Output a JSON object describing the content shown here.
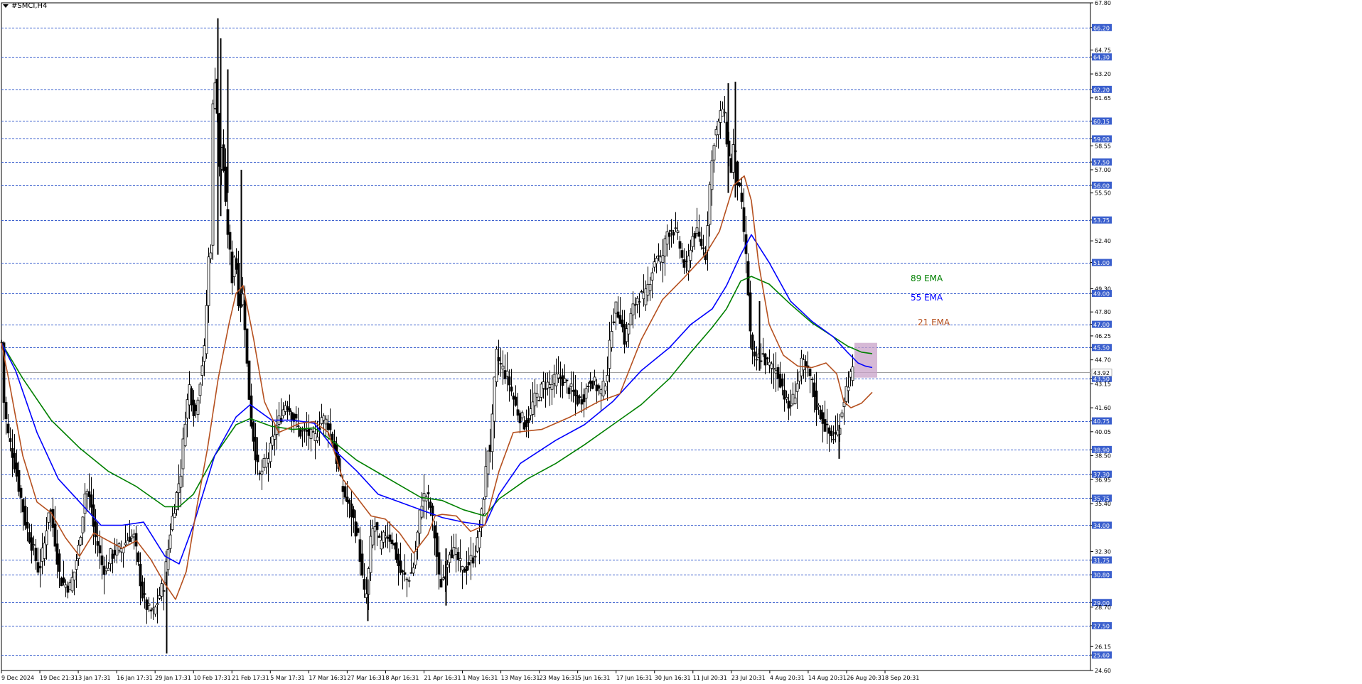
{
  "window": {
    "symbol_title": "#SMCI,H4"
  },
  "colors": {
    "grid": "#3a5fcd",
    "axis": "#000000",
    "ema21": "#b5501f",
    "ema55": "#0000ff",
    "ema89": "#008000",
    "highlight": "#c8a2c8",
    "price_label_bg": "#3a5fcd",
    "candle": "#000000"
  },
  "chart_data": {
    "type": "candlestick",
    "title": "#SMCI,H4",
    "ylim": [
      24.6,
      67.8
    ],
    "grid": true,
    "y_ticks": [
      "67.80",
      "66.20",
      "64.75",
      "64.30",
      "63.20",
      "62.20",
      "61.65",
      "60.15",
      "59.00",
      "58.55",
      "57.50",
      "57.00",
      "56.00",
      "55.50",
      "53.75",
      "52.40",
      "51.00",
      "49.30",
      "49.00",
      "47.80",
      "47.00",
      "46.25",
      "45.50",
      "44.70",
      "43.50",
      "43.15",
      "41.60",
      "40.75",
      "40.05",
      "38.90",
      "38.50",
      "37.30",
      "36.95",
      "35.75",
      "35.40",
      "34.00",
      "32.30",
      "31.75",
      "30.80",
      "29.00",
      "28.70",
      "27.50",
      "26.15",
      "25.60",
      "24.60"
    ],
    "grid_levels": [
      "66.20",
      "64.30",
      "62.20",
      "60.15",
      "59.00",
      "57.50",
      "56.00",
      "53.75",
      "51.00",
      "49.00",
      "47.00",
      "45.50",
      "43.50",
      "40.75",
      "38.90",
      "37.30",
      "35.75",
      "34.00",
      "31.75",
      "30.80",
      "29.00",
      "27.50",
      "25.60"
    ],
    "current_price": {
      "value": 43.92,
      "label": "43.92"
    },
    "x_labels": [
      "9 Dec 2024",
      "19 Dec 21:31",
      "3 Jan 17:31",
      "16 Jan 17:31",
      "29 Jan 17:31",
      "10 Feb 17:31",
      "21 Feb 17:31",
      "5 Mar 17:31",
      "17 Mar 16:31",
      "27 Mar 16:31",
      "8 Apr 16:31",
      "21 Apr 16:31",
      "1 May 16:31",
      "13 May 16:31",
      "23 May 16:31",
      "5 Jun 16:31",
      "17 Jun 16:31",
      "30 Jun 16:31",
      "11 Jul 20:31",
      "23 Jul 20:31",
      "4 Aug 20:31",
      "14 Aug 20:31",
      "26 Aug 20:31",
      "8 Sep 20:31"
    ],
    "close_path": {
      "t": [
        0,
        3,
        8,
        16,
        24,
        34,
        44,
        52,
        60,
        67,
        75,
        82,
        88,
        96,
        102,
        108,
        112,
        118,
        126,
        130,
        136,
        140,
        148,
        152,
        160,
        168,
        180,
        186,
        198,
        206,
        214,
        222,
        228,
        238,
        246,
        252,
        258,
        264,
        272,
        276,
        282,
        286,
        290,
        294,
        298,
        302,
        306,
        310,
        314,
        318,
        324,
        328,
        334,
        340,
        344,
        350,
        356,
        362,
        370,
        376,
        384,
        392,
        400,
        410,
        420,
        430,
        440,
        450,
        460,
        468,
        478,
        486,
        494,
        502,
        508,
        512,
        516,
        520,
        526,
        532,
        540,
        550,
        560,
        570,
        578,
        584,
        590,
        596,
        602,
        610,
        616,
        624,
        630,
        640,
        648,
        656,
        664,
        670,
        676,
        680,
        684,
        688,
        692,
        696,
        700,
        706,
        712,
        718,
        724,
        730,
        736,
        742,
        748,
        756,
        764,
        772,
        780,
        788,
        796,
        804,
        812,
        820,
        828,
        836,
        844,
        852,
        858,
        864,
        870,
        876,
        882,
        888,
        896,
        904,
        912,
        920,
        928,
        936,
        944,
        952,
        958,
        964,
        970,
        976,
        984,
        990,
        996,
        1002,
        1008,
        1014,
        1018,
        1022,
        1026,
        1030,
        1034,
        1040,
        1046,
        1050,
        1054,
        1058,
        1064,
        1070,
        1076,
        1082,
        1090,
        1098,
        1106,
        1114,
        1120,
        1126,
        1132,
        1138,
        1146,
        1152,
        1160,
        1166,
        1172,
        1176,
        1180,
        1186,
        1192,
        1198,
        1204,
        1210,
        1216,
        1220,
        1224,
        1228
      ],
      "close": [
        45.8,
        42,
        40,
        38.5,
        36.5,
        34,
        32.5,
        31,
        32.8,
        35.4,
        33,
        30.5,
        30.2,
        30,
        31,
        32.5,
        34,
        36.5,
        35.2,
        33.5,
        32.6,
        31.5,
        31,
        32,
        32.3,
        32.5,
        33.3,
        33.2,
        29.5,
        28.5,
        28.3,
        29.5,
        30.2,
        34,
        36,
        37.5,
        41,
        43,
        41,
        42.5,
        44.5,
        45.5,
        51,
        52,
        64,
        62,
        57,
        59,
        55,
        53,
        50,
        52,
        48,
        49,
        45,
        41,
        39,
        37,
        38,
        38.5,
        40,
        41,
        42,
        41,
        40,
        40,
        39.5,
        41,
        40.5,
        39,
        36.5,
        35.5,
        34.5,
        33,
        30,
        29,
        31,
        33.5,
        34,
        32.5,
        33.5,
        33,
        31,
        30.5,
        31,
        33,
        35.5,
        36,
        35.5,
        33,
        30,
        31,
        32.5,
        32,
        31,
        31.5,
        32,
        33,
        35,
        37,
        39,
        39,
        42.5,
        45,
        44.5,
        44,
        43.5,
        42.5,
        41.5,
        41,
        40.5,
        41,
        42,
        42.5,
        43.2,
        43,
        43.5,
        43.5,
        43,
        42.5,
        42,
        42.5,
        43.5,
        43,
        42.5,
        44,
        47,
        48,
        47.5,
        46,
        47,
        48,
        49,
        48.5,
        50,
        51.5,
        51,
        53,
        53.2,
        52.5,
        51,
        50.5,
        52.5,
        53,
        52.2,
        51.5,
        56,
        59,
        60,
        61,
        60,
        58,
        57,
        59,
        56.5,
        55,
        52,
        49,
        45.5,
        44.5,
        44.8,
        45,
        44.5,
        44.2,
        44,
        43,
        41.5,
        42.2,
        43.5,
        44.5,
        44,
        43.5,
        41.8,
        41.2,
        40.2,
        39.8,
        39.7,
        40,
        41,
        42.5,
        43.5,
        43.9
      ]
    },
    "ema21": {
      "name": "21 EMA",
      "t": [
        0,
        10,
        30,
        50,
        70,
        90,
        110,
        130,
        150,
        170,
        190,
        210,
        230,
        245,
        260,
        275,
        290,
        305,
        320,
        330,
        340,
        355,
        370,
        390,
        420,
        440,
        460,
        480,
        500,
        520,
        540,
        560,
        580,
        600,
        610,
        620,
        640,
        660,
        680,
        700,
        720,
        760,
        800,
        840,
        870,
        900,
        930,
        960,
        990,
        1010,
        1030,
        1045,
        1055,
        1065,
        1080,
        1100,
        1120,
        1140,
        1160,
        1175,
        1185,
        1195,
        1210,
        1225
      ],
      "value": [
        45.8,
        43.5,
        38.5,
        35.5,
        34.8,
        33.2,
        32,
        33.5,
        33,
        32.5,
        33,
        31.8,
        30.2,
        29.2,
        31,
        35.2,
        39,
        43.5,
        47,
        49,
        49.5,
        46,
        42,
        40,
        40.6,
        40.7,
        40,
        37,
        35.8,
        34.6,
        34.4,
        33.5,
        32.2,
        33.4,
        34.6,
        34.7,
        34.6,
        33.6,
        34,
        37.5,
        40,
        40.2,
        41,
        42,
        42.5,
        46,
        48.6,
        50,
        51.5,
        53,
        56,
        56.6,
        55,
        51,
        47,
        45,
        44.3,
        44.2,
        44.5,
        43.8,
        42,
        41.6,
        41.9,
        42.6
      ]
    },
    "ema55": {
      "name": "55 EMA",
      "t": [
        0,
        20,
        50,
        80,
        110,
        140,
        170,
        200,
        230,
        250,
        270,
        300,
        330,
        350,
        380,
        410,
        440,
        470,
        500,
        530,
        560,
        590,
        620,
        650,
        680,
        700,
        730,
        780,
        820,
        860,
        900,
        940,
        970,
        1000,
        1020,
        1040,
        1055,
        1080,
        1110,
        1140,
        1170,
        1190,
        1205,
        1215,
        1225
      ],
      "value": [
        45.8,
        44,
        40,
        37,
        35.5,
        34,
        34,
        34.2,
        32,
        31.5,
        34,
        38.5,
        41,
        41.8,
        40.8,
        40.8,
        40.6,
        38.8,
        37.5,
        36,
        35.5,
        35,
        34.5,
        34.2,
        34,
        36,
        38,
        39.5,
        40.5,
        42,
        44,
        45.5,
        47,
        48,
        49.5,
        51.5,
        52.8,
        51,
        48.5,
        47.2,
        46.2,
        45.2,
        44.5,
        44.3,
        44.2
      ]
    },
    "ema89": {
      "name": "89 EMA",
      "t": [
        0,
        30,
        70,
        110,
        150,
        190,
        230,
        250,
        270,
        300,
        330,
        350,
        380,
        410,
        440,
        470,
        500,
        530,
        560,
        590,
        620,
        650,
        680,
        700,
        740,
        780,
        820,
        860,
        900,
        940,
        970,
        1000,
        1020,
        1040,
        1055,
        1080,
        1110,
        1140,
        1170,
        1190,
        1210,
        1225
      ],
      "value": [
        45.8,
        43.5,
        40.8,
        39,
        37.5,
        36.5,
        35.2,
        35.2,
        36,
        38.5,
        40.5,
        40.9,
        40.4,
        40.2,
        40.3,
        39.3,
        38.2,
        37.4,
        36.6,
        35.8,
        35.6,
        35,
        34.6,
        35.7,
        37,
        38,
        39.2,
        40.5,
        41.8,
        43.5,
        45.2,
        46.8,
        48,
        49.8,
        50.1,
        49.6,
        48.3,
        47.1,
        46.2,
        45.6,
        45.2,
        45.1
      ]
    },
    "spikes": [
      {
        "t": 304,
        "high": 66.8,
        "low": 51.5
      },
      {
        "t": 308,
        "high": 65.5,
        "low": 54
      },
      {
        "t": 318,
        "high": 63.5,
        "low": 55.5
      },
      {
        "t": 337,
        "high": 57,
        "low": 49
      },
      {
        "t": 1022,
        "high": 62.6,
        "low": 55.5
      },
      {
        "t": 1032,
        "high": 62.7,
        "low": 55.2
      },
      {
        "t": 232,
        "high": 31,
        "low": 25.7
      },
      {
        "t": 515,
        "high": 30.5,
        "low": 27.8
      },
      {
        "t": 625,
        "high": 32.5,
        "low": 28.8
      },
      {
        "t": 1066,
        "high": 48.5,
        "low": 44
      },
      {
        "t": 1178,
        "high": 40.5,
        "low": 38.3
      }
    ],
    "annotations": [
      {
        "text": "89 EMA",
        "series": "ema89"
      },
      {
        "text": "55 EMA",
        "series": "ema55"
      },
      {
        "text": "21 EMA",
        "series": "ema21"
      }
    ],
    "highlight_box": {
      "t0": 1200,
      "t1": 1232,
      "y_top": 45.8,
      "y_bottom": 43.55
    }
  }
}
